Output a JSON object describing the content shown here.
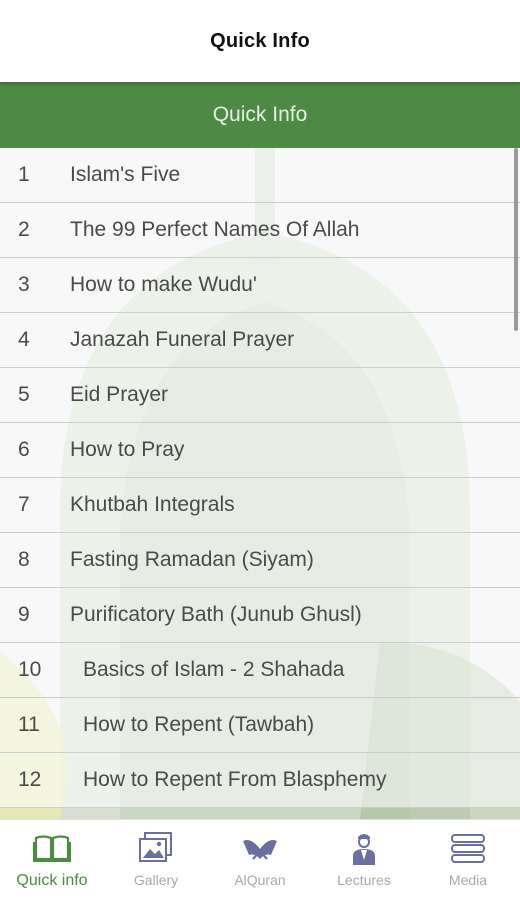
{
  "appbar": {
    "title": "Quick Info"
  },
  "section": {
    "header": "Quick Info"
  },
  "items": [
    {
      "num": "1",
      "label": "Islam's Five"
    },
    {
      "num": "2",
      "label": "The 99 Perfect Names Of Allah"
    },
    {
      "num": "3",
      "label": "How to make Wudu'"
    },
    {
      "num": "4",
      "label": "Janazah Funeral Prayer"
    },
    {
      "num": "5",
      "label": "Eid Prayer"
    },
    {
      "num": "6",
      "label": "How to Pray"
    },
    {
      "num": "7",
      "label": "Khutbah Integrals"
    },
    {
      "num": "8",
      "label": "Fasting Ramadan (Siyam)"
    },
    {
      "num": "9",
      "label": "Purificatory Bath (Junub Ghusl)"
    },
    {
      "num": "10",
      "label": "Basics of Islam - 2 Shahada"
    },
    {
      "num": "11",
      "label": "How to Repent (Tawbah)"
    },
    {
      "num": "12",
      "label": "How to Repent From Blasphemy"
    }
  ],
  "nav": [
    {
      "label": "Quick info",
      "icon": "book-icon"
    },
    {
      "label": "Gallery",
      "icon": "gallery-icon"
    },
    {
      "label": "AlQuran",
      "icon": "quran-icon"
    },
    {
      "label": "Lectures",
      "icon": "lecturer-icon"
    },
    {
      "label": "Media",
      "icon": "media-stack-icon"
    }
  ],
  "colors": {
    "accent": "#4e8a45",
    "inactive": "#a9a9a9",
    "text": "#4a4a4a"
  }
}
